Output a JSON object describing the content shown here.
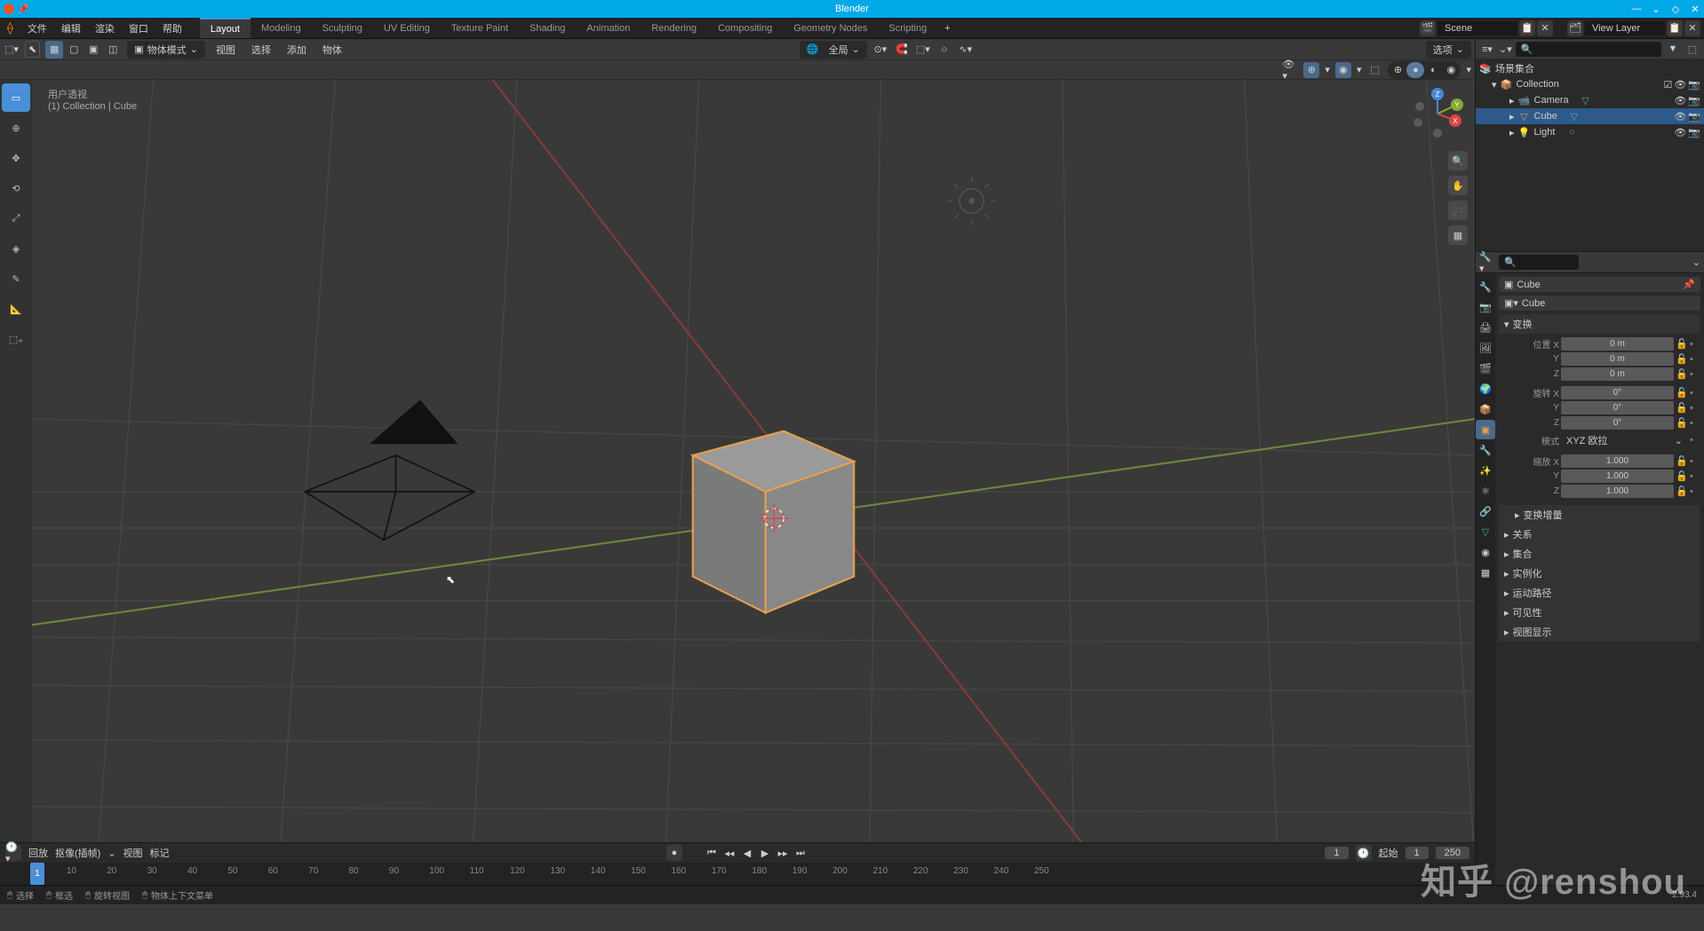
{
  "app_title": "Blender",
  "menus": {
    "file": "文件",
    "edit": "编辑",
    "render": "渲染",
    "window": "窗口",
    "help": "帮助"
  },
  "workspaces": [
    "Layout",
    "Modeling",
    "Sculpting",
    "UV Editing",
    "Texture Paint",
    "Shading",
    "Animation",
    "Rendering",
    "Compositing",
    "Geometry Nodes",
    "Scripting"
  ],
  "active_workspace": "Layout",
  "scene_name": "Scene",
  "view_layer": "View Layer",
  "viewport": {
    "mode": "物体模式",
    "menus": {
      "view": "视图",
      "select": "选择",
      "add": "添加",
      "object": "物体"
    },
    "orientation": "全局",
    "options_label": "选项",
    "overlay_title1": "用户透视",
    "overlay_title2": "(1) Collection | Cube"
  },
  "outliner": {
    "root": "场景集合",
    "collection": "Collection",
    "items": [
      {
        "name": "Camera",
        "icon": "camera"
      },
      {
        "name": "Cube",
        "icon": "mesh",
        "selected": true
      },
      {
        "name": "Light",
        "icon": "light"
      }
    ]
  },
  "properties": {
    "object_name": "Cube",
    "data_name": "Cube",
    "sections": {
      "transform": "变换",
      "delta": "变换增量",
      "relations": "关系",
      "collections": "集合",
      "instancing": "实例化",
      "motion": "运动路径",
      "visibility": "可见性",
      "viewport": "视图显示"
    },
    "labels": {
      "locX": "位置 X",
      "rotX": "旋转 X",
      "sclX": "缩放 X",
      "mode": "模式",
      "Y": "Y",
      "Z": "Z"
    },
    "loc": {
      "x": "0 m",
      "y": "0 m",
      "z": "0 m"
    },
    "rot": {
      "x": "0°",
      "y": "0°",
      "z": "0°"
    },
    "rot_mode": "XYZ 欧拉",
    "scl": {
      "x": "1.000",
      "y": "1.000",
      "z": "1.000"
    }
  },
  "timeline": {
    "playback": "回放",
    "keying": "抠像(插帧)",
    "view": "视图",
    "marker": "标记",
    "current": 1,
    "start_label": "起始",
    "start": 1,
    "end": 250,
    "ticks": [
      1,
      10,
      20,
      30,
      40,
      50,
      60,
      70,
      80,
      90,
      100,
      110,
      120,
      130,
      140,
      150,
      160,
      170,
      180,
      190,
      200,
      210,
      220,
      230,
      240,
      250
    ]
  },
  "status": {
    "select": "选择",
    "box": "框选",
    "rotate": "旋转视图",
    "context": "物体上下文菜单",
    "version": "2.93.4"
  },
  "watermark": "知乎 @renshou"
}
